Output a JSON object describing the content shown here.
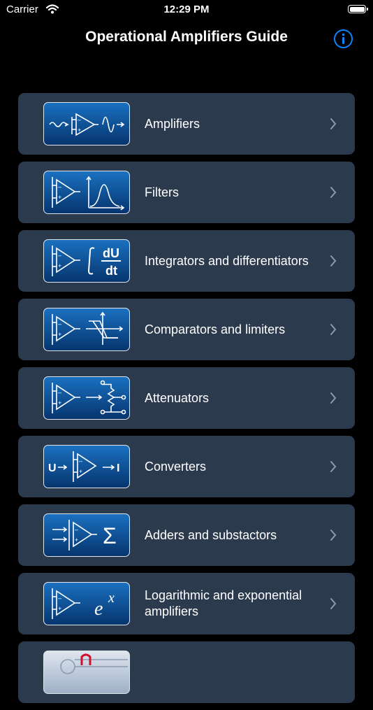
{
  "status_bar": {
    "carrier": "Carrier",
    "time": "12:29 PM"
  },
  "nav": {
    "title": "Operational Amplifiers Guide",
    "info_icon": "info-circle-icon"
  },
  "colors": {
    "accent": "#0a84ff",
    "row_bg": "#2c3a4e",
    "thumb_top": "#1a71c0",
    "thumb_bottom": "#06356e",
    "chevron": "#8e9aa9"
  },
  "items": [
    {
      "label": "Amplifiers",
      "icon": "amplifier-sine-icon"
    },
    {
      "label": "Filters",
      "icon": "filter-curve-icon"
    },
    {
      "label": "Integrators and differentiators",
      "icon": "integrator-icon"
    },
    {
      "label": "Comparators and limiters",
      "icon": "comparator-icon"
    },
    {
      "label": "Attenuators",
      "icon": "attenuator-icon"
    },
    {
      "label": "Converters",
      "icon": "converter-icon"
    },
    {
      "label": "Adders and substactors",
      "icon": "adder-sigma-icon"
    },
    {
      "label": "Logarithmic and exponential amplifiers",
      "icon": "exponential-icon"
    },
    {
      "label": "",
      "icon": "circuit-icon"
    }
  ],
  "thumb_text": {
    "du": "dU",
    "dt": "dt",
    "u": "U",
    "i": "I",
    "sigma": "Σ",
    "exp_base": "e",
    "exp_power": "x"
  }
}
